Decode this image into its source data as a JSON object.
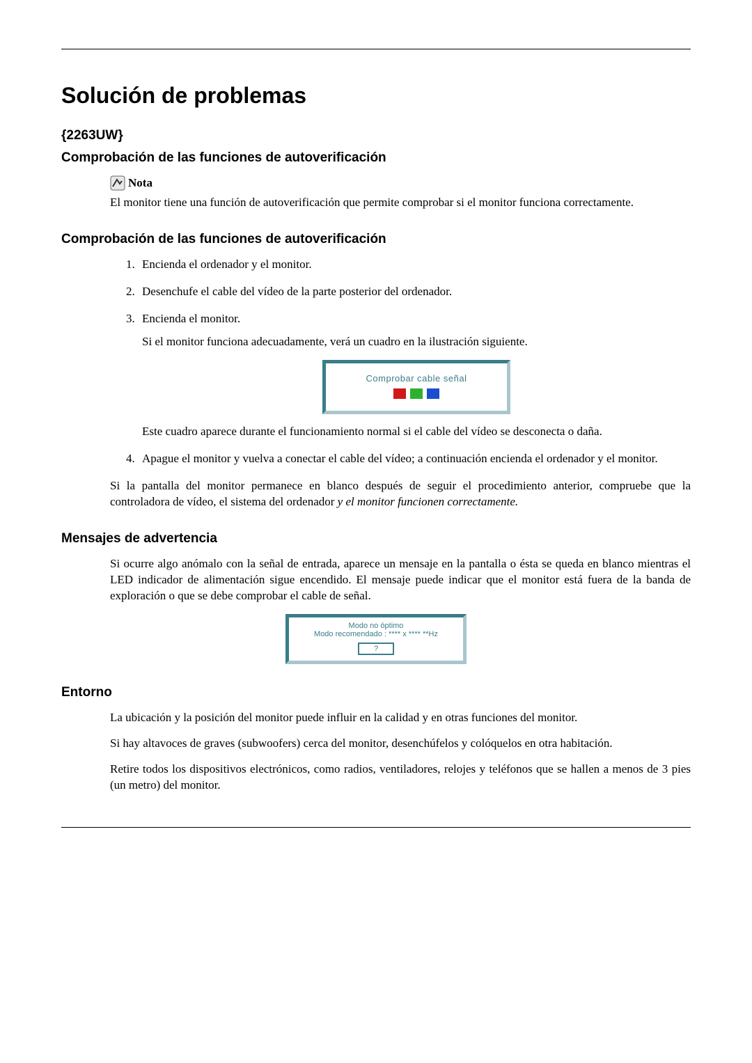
{
  "title": "Solución de problemas",
  "model": "{2263UW}",
  "sec_autoverif_1": "Comprobación de las funciones de autoverificación",
  "note": {
    "label": "Nota",
    "text": "El monitor tiene una función de autoverificación que permite comprobar si el monitor funciona correctamente."
  },
  "sec_autoverif_2": "Comprobación de las funciones de autoverificación",
  "steps": {
    "s1": "Encienda el ordenador y el monitor.",
    "s2": "Desenchufe el cable del vídeo de la parte posterior del ordenador.",
    "s3": "Encienda el monitor.",
    "s3_after": "Si el monitor funciona adecuadamente, verá un cuadro en la ilustración siguiente.",
    "s3_after2": "Este cuadro aparece durante el funcionamiento normal si el cable del vídeo se desconecta o daña.",
    "s4": "Apague el monitor y vuelva a conectar el cable del vídeo; a continuación encienda el ordenador y el monitor."
  },
  "osd1_text": "Comprobar cable señal",
  "after_steps_p1_a": "Si la pantalla del monitor permanece en blanco después de seguir el procedimiento anterior, compruebe que la controladora de vídeo, el sistema del ordenador ",
  "after_steps_p1_b": "y el monitor funcionen correctamente.",
  "sec_mensajes": "Mensajes de advertencia",
  "mensajes_p": "Si ocurre algo anómalo con la señal de entrada, aparece un mensaje en la pantalla o ésta se queda en blanco mientras el LED indicador de alimentación sigue encendido. El mensaje puede indicar que el monitor está fuera de la banda de exploración o que se debe comprobar el cable de señal.",
  "osd2": {
    "line1": "Modo no óptimo",
    "line2": "Modo recomendado : **** x ****  **Hz",
    "btn": "?"
  },
  "sec_entorno": "Entorno",
  "entorno_p1": "La ubicación y la posición del monitor puede influir en la calidad y en otras funciones del monitor.",
  "entorno_p2": "Si hay altavoces de graves (subwoofers) cerca del monitor, desenchúfelos y colóquelos en otra habitación.",
  "entorno_p3": "Retire todos los dispositivos electrónicos, como radios, ventiladores, relojes y teléfonos que se hallen a menos de 3 pies (un metro) del monitor."
}
